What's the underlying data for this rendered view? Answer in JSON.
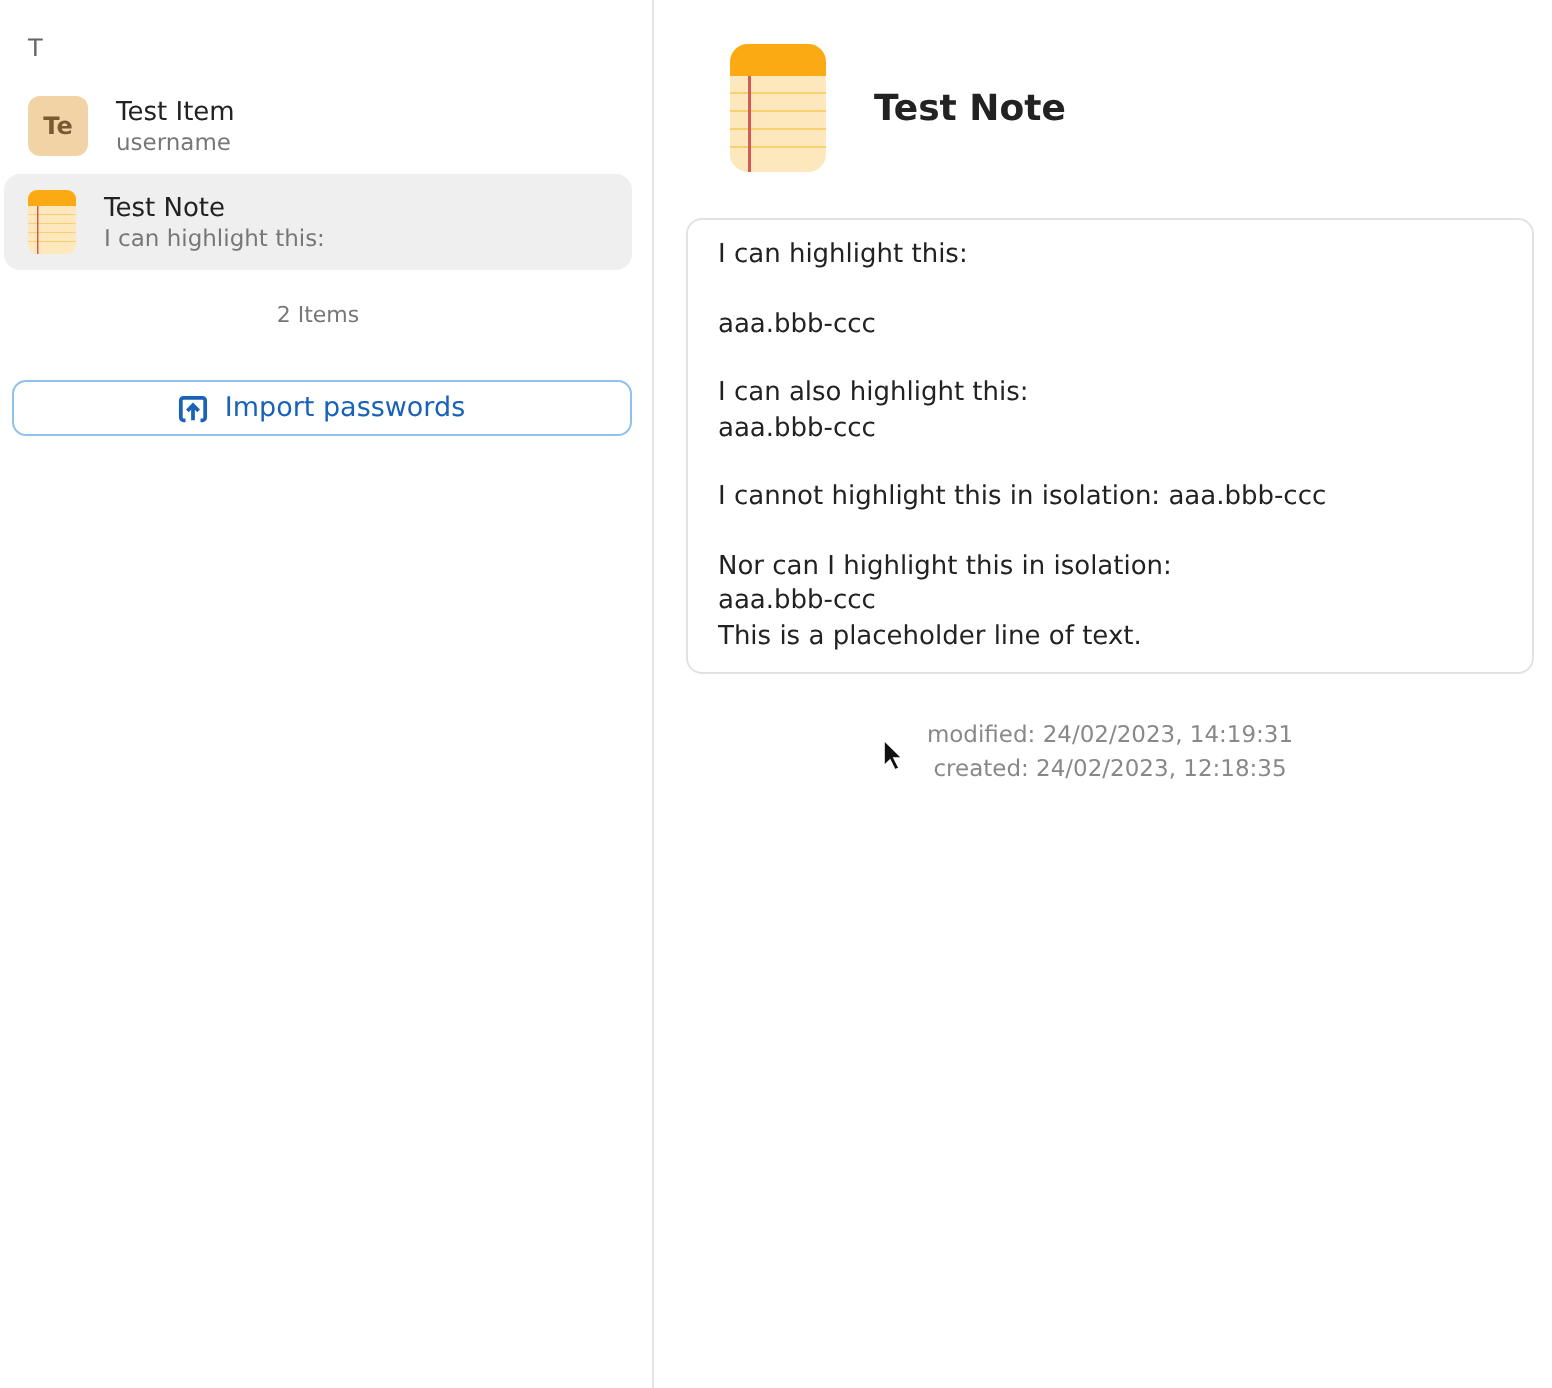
{
  "sidebar": {
    "section_letter": "T",
    "items": [
      {
        "kind": "avatar",
        "avatar_text": "Te",
        "title": "Test Item",
        "subtitle": "username",
        "selected": false
      },
      {
        "kind": "note",
        "title": "Test Note",
        "subtitle": "I can highlight this:",
        "selected": true
      }
    ],
    "count": "2 Items",
    "import_button": "Import passwords"
  },
  "detail": {
    "title": "Test Note",
    "note_paragraphs": [
      [
        "I can highlight this:"
      ],
      [
        "aaa.bbb-ccc"
      ],
      [
        "I can also highlight this:",
        "aaa.bbb-ccc"
      ],
      [
        "I cannot highlight this in isolation: aaa.bbb-ccc"
      ],
      [
        "Nor can I highlight this in isolation:",
        "aaa.bbb-ccc",
        "This is a placeholder line of text."
      ]
    ],
    "modified": "modified: 24/02/2023, 14:19:31",
    "created": "created: 24/02/2023, 12:18:35"
  }
}
